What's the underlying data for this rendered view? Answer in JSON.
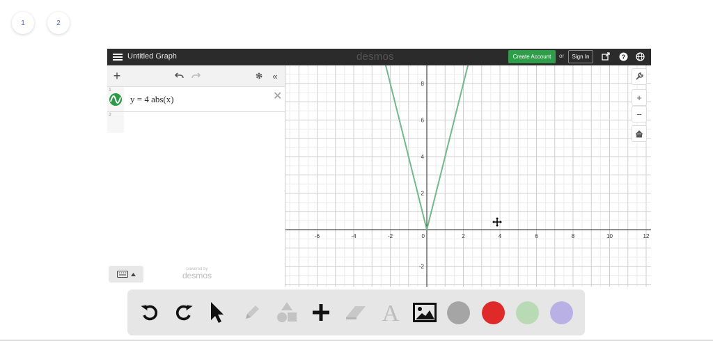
{
  "pages": [
    "1",
    "2"
  ],
  "topbar": {
    "title": "Untitled Graph",
    "brand": "desmos",
    "create_account": "Create Account",
    "or": "or",
    "sign_in": "Sign In"
  },
  "expressions": [
    {
      "index": "1",
      "latex_display": "y = 4 abs(x)",
      "color": "#2d9a45"
    },
    {
      "index": "2",
      "latex_display": ""
    }
  ],
  "powered_by": {
    "small": "powered by",
    "brand": "desmos"
  },
  "graph": {
    "x_ticks": [
      "-6",
      "-4",
      "-2",
      "0",
      "2",
      "4",
      "6",
      "8",
      "10",
      "12"
    ],
    "y_ticks": [
      "8",
      "6",
      "4",
      "2",
      "-2"
    ],
    "curve_color": "#6fb98a",
    "function": "y = 4|x|"
  },
  "toolbar": {
    "tools": [
      "undo-icon",
      "redo-icon",
      "pointer-icon",
      "pencil-icon",
      "shapes-icon",
      "plus-icon",
      "eraser-icon",
      "text-icon",
      "image-icon"
    ],
    "colors": [
      "#a5a5a5",
      "#e02a2a",
      "#b8dbb5",
      "#b9b1e5"
    ]
  }
}
